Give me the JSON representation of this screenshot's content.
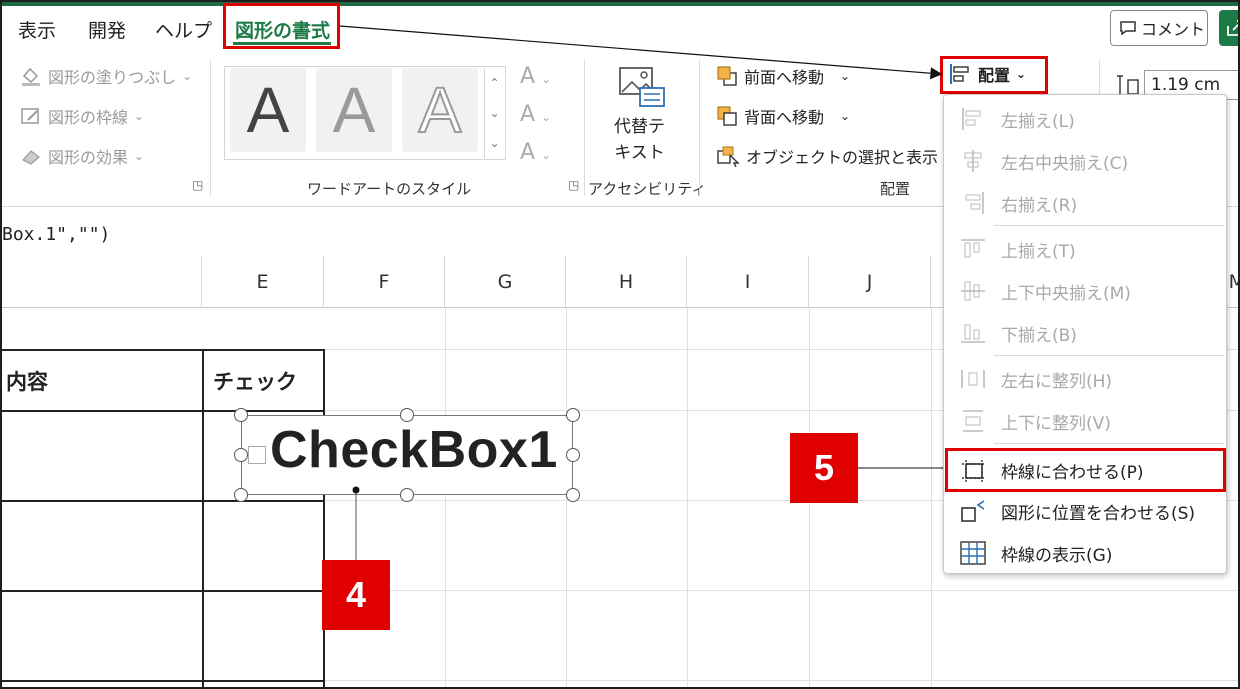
{
  "tabs": [
    {
      "label": "表示",
      "active": false
    },
    {
      "label": "開発",
      "active": false
    },
    {
      "label": "ヘルプ",
      "active": false
    },
    {
      "label": "図形の書式",
      "active": true
    }
  ],
  "comment_button": "コメント",
  "shape_styles": {
    "fill": "図形の塗りつぶし",
    "outline": "図形の枠線",
    "effects": "図形の効果"
  },
  "wordart": {
    "sample_glyph": "A",
    "group_label": "ワードアートのスタイル"
  },
  "accessibility": {
    "alt_text_line1": "代替テ",
    "alt_text_line2": "キスト",
    "group_label": "アクセシビリティ"
  },
  "arrange": {
    "bring_forward": "前面へ移動",
    "send_backward": "背面へ移動",
    "selection_pane": "オブジェクトの選択と表示",
    "group_label": "配置",
    "align_button": "配置"
  },
  "size": {
    "height": "1.19 cm"
  },
  "formula_bar": {
    "text": "Box.1\",\"\")"
  },
  "columns": [
    "E",
    "F",
    "G",
    "H",
    "I",
    "J",
    "M"
  ],
  "sheet": {
    "header_content": "内容",
    "header_check": "チェック"
  },
  "checkbox": {
    "label": "CheckBox1"
  },
  "align_menu": {
    "items": [
      {
        "label": "左揃え(L)",
        "enabled": false,
        "icon": "align-left-icon"
      },
      {
        "label": "左右中央揃え(C)",
        "enabled": false,
        "icon": "align-center-icon"
      },
      {
        "label": "右揃え(R)",
        "enabled": false,
        "icon": "align-right-icon"
      },
      {
        "label": "上揃え(T)",
        "enabled": false,
        "icon": "align-top-icon"
      },
      {
        "label": "上下中央揃え(M)",
        "enabled": false,
        "icon": "align-middle-icon"
      },
      {
        "label": "下揃え(B)",
        "enabled": false,
        "icon": "align-bottom-icon"
      },
      {
        "label": "左右に整列(H)",
        "enabled": false,
        "icon": "distribute-horizontal-icon"
      },
      {
        "label": "上下に整列(V)",
        "enabled": false,
        "icon": "distribute-vertical-icon"
      },
      {
        "label": "枠線に合わせる(P)",
        "enabled": true,
        "icon": "snap-to-grid-icon",
        "highlighted": true
      },
      {
        "label": "図形に位置を合わせる(S)",
        "enabled": true,
        "icon": "snap-to-shape-icon"
      },
      {
        "label": "枠線の表示(G)",
        "enabled": true,
        "icon": "view-gridlines-icon"
      }
    ]
  },
  "annotations": {
    "step4": "4",
    "step5": "5"
  },
  "colors": {
    "accent": "#1e7a45",
    "highlight": "#e00000"
  }
}
